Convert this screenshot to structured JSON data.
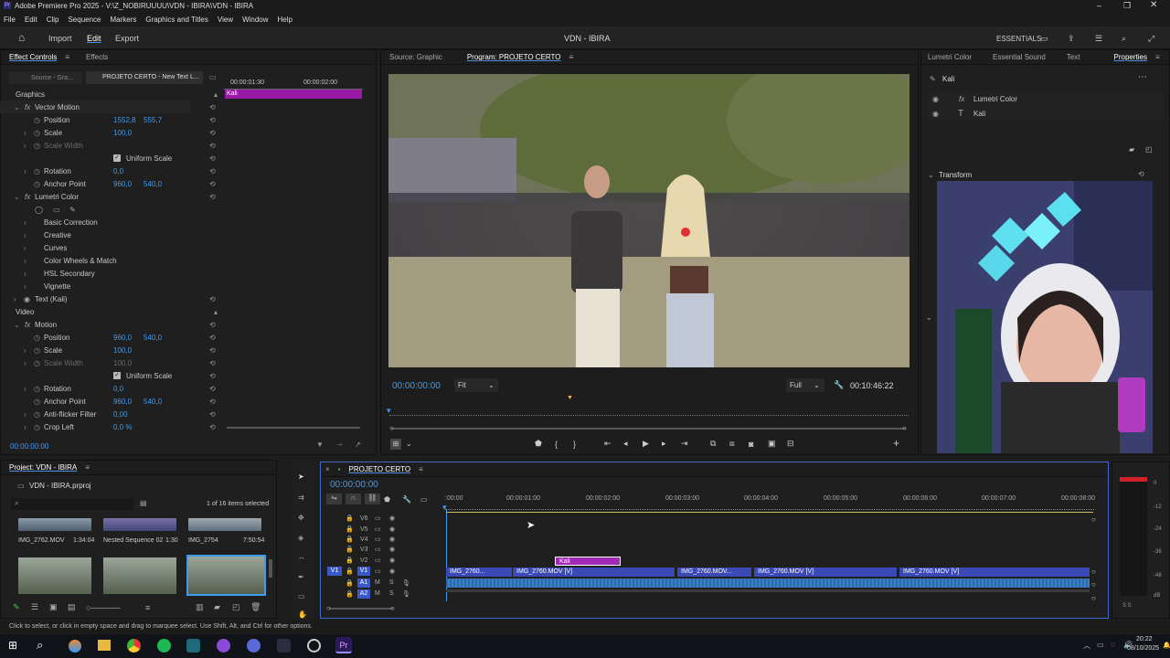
{
  "window": {
    "title": "Adobe Premiere Pro 2025 - V:\\Z_NOBIRUUUU\\VDN - IBIRA\\VDN - IBIRA"
  },
  "menu": [
    "File",
    "Edit",
    "Clip",
    "Sequence",
    "Markers",
    "Graphics and Titles",
    "View",
    "Window",
    "Help"
  ],
  "topnav": {
    "import": "Import",
    "edit": "Edit",
    "export": "Export",
    "project_title": "VDN - IBIRA",
    "workspace": "ESSENTIALS"
  },
  "effect_controls": {
    "tabs": [
      "Effect Controls",
      "Effects"
    ],
    "source_dropdown": "Source - Gra...",
    "sequence_dropdown": "PROJETO CERTO - New Text L...",
    "timecode_start": "00:00:01:30",
    "timecode_end": "00:00:02:00",
    "clip_label": "Kali",
    "graphics_header": "Graphics",
    "vector_motion": "Vector Motion",
    "rows": [
      {
        "label": "Position",
        "v1": "1552,8",
        "v2": "555,7"
      },
      {
        "label": "Scale",
        "v1": "100,0",
        "v2": ""
      },
      {
        "label": "Scale Width",
        "v1": "",
        "v2": ""
      },
      {
        "label": "Uniform Scale",
        "v1": "",
        "v2": ""
      },
      {
        "label": "Rotation",
        "v1": "0,0",
        "v2": ""
      },
      {
        "label": "Anchor Point",
        "v1": "960,0",
        "v2": "540,0"
      }
    ],
    "lumetri": "Lumetri Color",
    "lumetri_items": [
      "Basic Correction",
      "Creative",
      "Curves",
      "Color Wheels & Match",
      "HSL Secondary",
      "Vignette"
    ],
    "text_kali": "Text (Kali)",
    "video_header": "Video",
    "motion": "Motion",
    "motion_rows": [
      {
        "label": "Position",
        "v1": "960,0",
        "v2": "540,0"
      },
      {
        "label": "Scale",
        "v1": "100,0",
        "v2": ""
      },
      {
        "label": "Scale Width",
        "v1": "100,0",
        "v2": ""
      },
      {
        "label": "Uniform Scale",
        "v1": "",
        "v2": ""
      },
      {
        "label": "Rotation",
        "v1": "0,0",
        "v2": ""
      },
      {
        "label": "Anchor Point",
        "v1": "960,0",
        "v2": "540,0"
      },
      {
        "label": "Anti-flicker Filter",
        "v1": "0,00",
        "v2": ""
      },
      {
        "label": "Crop Left",
        "v1": "0,0 %",
        "v2": ""
      }
    ],
    "footer_timecode": "00:00:00:00"
  },
  "program": {
    "source_tab": "Source: Graphic",
    "program_tab": "Program: PROJETO CERTO",
    "timecode": "00:00:00:00",
    "fit": "Fit",
    "quality": "Full",
    "duration": "00:10:46:22"
  },
  "properties": {
    "tabs": [
      "Lumetri Color",
      "Essential Sound",
      "Text",
      "Properties"
    ],
    "item_name": "Kali",
    "effects": [
      "Lumetri Color",
      "Kali"
    ],
    "transform": "Transform"
  },
  "project": {
    "title": "Project: VDN - IBIRA",
    "file": "VDN - IBIRA.prproj",
    "selected": "1 of 16 items selected",
    "items": [
      {
        "name": "IMG_2762.MOV",
        "dur": "1:34:04"
      },
      {
        "name": "Nested Sequence 02",
        "dur": "1:30"
      },
      {
        "name": "IMG_2754",
        "dur": "7:50:54"
      }
    ]
  },
  "timeline": {
    "tab": "PROJETO CERTO",
    "timecode": "00:00:00:00",
    "ticks": [
      ":00:00",
      "00:00:01:00",
      "00:00:02:00",
      "00:00:03:00",
      "00:00:04:00",
      "00:00:05:00",
      "00:00:06:00",
      "00:00:07:00",
      "00:00:08:00"
    ],
    "tracks": [
      "V6",
      "V5",
      "V4",
      "V3",
      "V2",
      "V1",
      "A1",
      "A2"
    ],
    "kali_clip": "Kali",
    "v1_clips": [
      "IMG_2760...",
      "IMG_2760.MOV [V]",
      "IMG_2760.MOV...",
      "IMG_2760.MOV [V]",
      "IMG_2760.MOV [V]"
    ]
  },
  "meter": {
    "labels": [
      "0",
      "-12",
      "-24",
      "-36",
      "-48",
      "dB"
    ],
    "bottom": "S S"
  },
  "status": "Click to select, or click in empty space and drag to marquee select. Use Shift, Alt, and Ctrl for other options.",
  "tray": {
    "time": "20:22",
    "date": "08/10/2025"
  },
  "colors": {
    "accent": "#3d9bf0",
    "clip": "#3b49b5",
    "audio": "#2c7a5a",
    "graphic": "#a020b0"
  }
}
